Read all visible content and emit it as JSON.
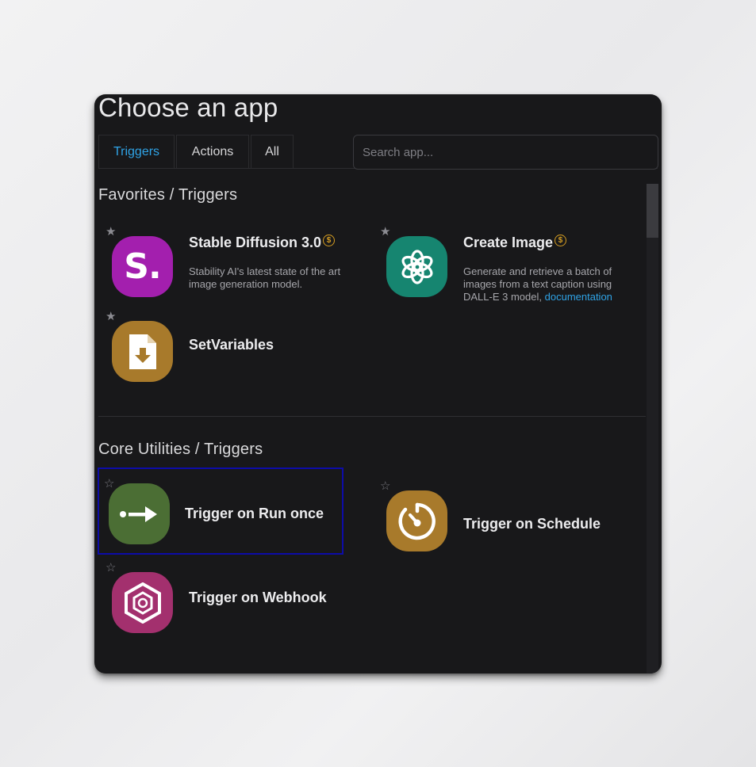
{
  "dialog": {
    "title": "Choose an app"
  },
  "tabs": [
    {
      "label": "Triggers",
      "active": true
    },
    {
      "label": "Actions",
      "active": false
    },
    {
      "label": "All",
      "active": false
    }
  ],
  "search": {
    "placeholder": "Search app...",
    "value": ""
  },
  "sections": [
    {
      "title": "Favorites / Triggers",
      "apps": [
        {
          "name": "Stable Diffusion 3.0",
          "paid": true,
          "coin_symbol": "$",
          "favorite": true,
          "description": "Stability AI's latest state of the art image generation model.",
          "icon": "stable-diffusion-icon",
          "icon_text": "S.",
          "icon_color": "#a31fae"
        },
        {
          "name": "Create Image",
          "paid": true,
          "coin_symbol": "$",
          "favorite": true,
          "description": "Generate and retrieve a batch of images from a text caption using DALL-E 3 model,",
          "link_text": "documentation",
          "icon": "openai-icon",
          "icon_color": "#168570"
        },
        {
          "name": "SetVariables",
          "paid": false,
          "favorite": true,
          "description": "",
          "icon": "file-download-icon",
          "icon_color": "#a87a2b"
        }
      ]
    },
    {
      "title": "Core Utilities / Triggers",
      "apps": [
        {
          "name": "Trigger on Run once",
          "favorite": false,
          "selected": true,
          "icon": "arrow-right-icon",
          "icon_color": "#4b6e34"
        },
        {
          "name": "Trigger on Schedule",
          "favorite": false,
          "icon": "timer-icon",
          "icon_color": "#a87a2b"
        },
        {
          "name": "Trigger on Webhook",
          "favorite": false,
          "icon": "webhook-icon",
          "icon_color": "#a3306e"
        }
      ]
    }
  ],
  "colors": {
    "accent": "#2fa3e6",
    "background": "#18181a",
    "coin": "#d39c22",
    "selection": "#0d0ca8"
  },
  "star_filled": "★",
  "star_empty": "☆"
}
